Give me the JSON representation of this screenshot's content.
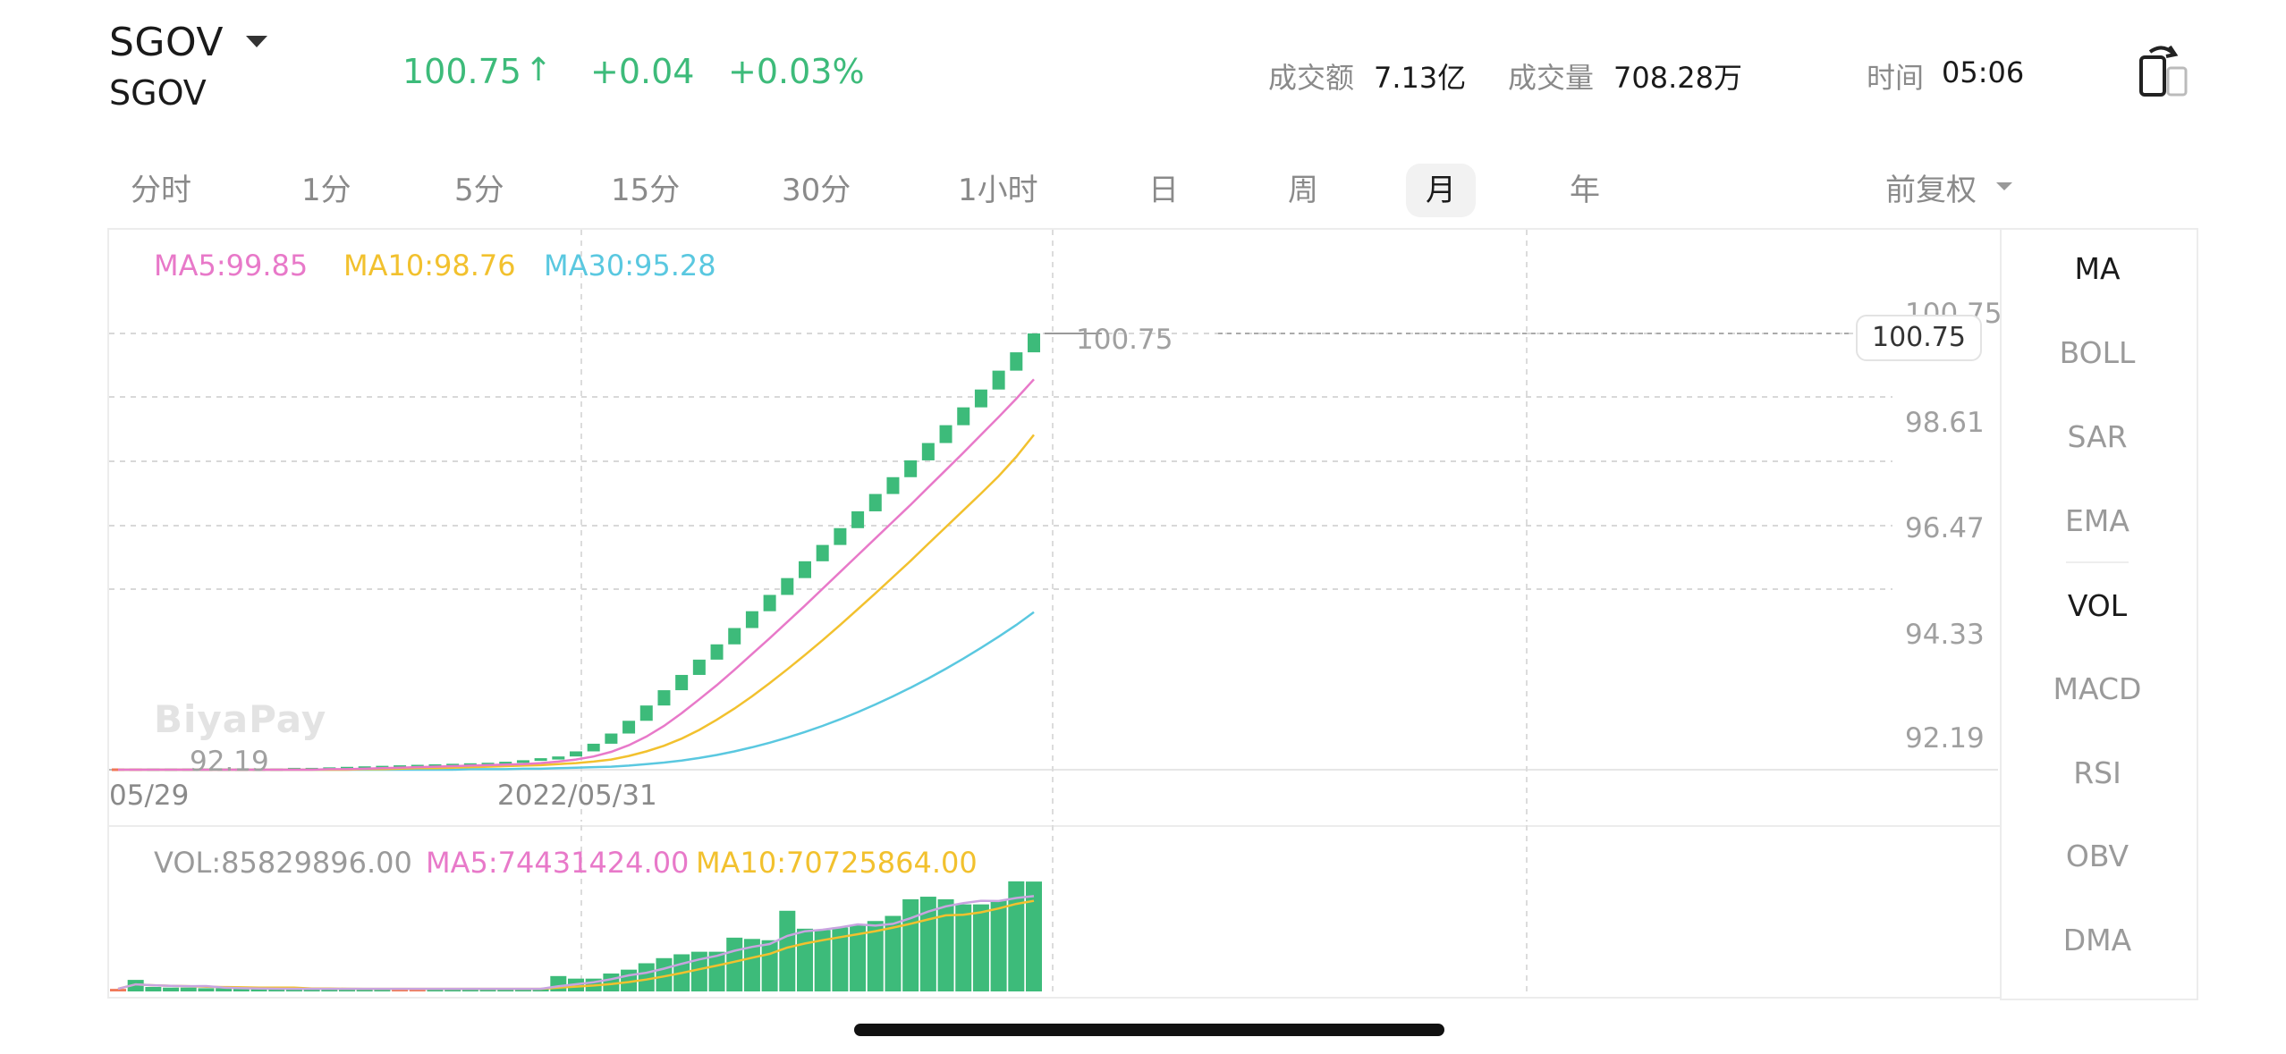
{
  "header": {
    "ticker": "SGOV",
    "name": "SGOV",
    "price": "100.75",
    "arrow": "↑",
    "change": "+0.04",
    "change_pct": "+0.03%",
    "turnover_label": "成交额",
    "turnover_value": "7.13亿",
    "volume_label": "成交量",
    "volume_value": "708.28万",
    "time_label": "时间",
    "time_value": "05:06"
  },
  "tabs": [
    {
      "label": "分时"
    },
    {
      "label": "1分"
    },
    {
      "label": "5分"
    },
    {
      "label": "15分"
    },
    {
      "label": "30分"
    },
    {
      "label": "1小时"
    },
    {
      "label": "日"
    },
    {
      "label": "周"
    },
    {
      "label": "月",
      "active": true
    },
    {
      "label": "年"
    }
  ],
  "adjust_label": "前复权",
  "indicators": {
    "main": [
      "MA",
      "BOLL",
      "SAR",
      "EMA"
    ],
    "sub": [
      "VOL",
      "MACD",
      "RSI",
      "OBV",
      "DMA"
    ],
    "active_main": "MA",
    "active_sub": "VOL"
  },
  "chart_legend": {
    "ma5": "MA5:99.85",
    "ma10": "MA10:98.76",
    "ma30": "MA30:95.28"
  },
  "vol_legend": {
    "vol": "VOL:85829896.00",
    "ma5": "MA5:74431424.00",
    "ma10": "MA10:70725864.00"
  },
  "watermark": "BiyaPay",
  "colors": {
    "up": "#3dbb7a",
    "down": "#f07858",
    "ma5": "#e879c9",
    "ma10": "#f2c12e",
    "ma30": "#5ac8e0"
  },
  "chart_data": {
    "type": "candlestick",
    "y_axis_labels": [
      "100.75",
      "98.61",
      "96.47",
      "94.33",
      "92.19"
    ],
    "ylim": [
      92.19,
      100.75
    ],
    "last_price_label": "100.75",
    "min_price_label": "92.19",
    "x_labels": [
      "05/29",
      "2022/05/31"
    ],
    "candles": [
      {
        "o": 92.19,
        "c": 92.19
      },
      {
        "o": 92.19,
        "c": 92.19
      },
      {
        "o": 92.19,
        "c": 92.19
      },
      {
        "o": 92.19,
        "c": 92.19
      },
      {
        "o": 92.19,
        "c": 92.19
      },
      {
        "o": 92.19,
        "c": 92.19
      },
      {
        "o": 92.19,
        "c": 92.19
      },
      {
        "o": 92.19,
        "c": 92.19
      },
      {
        "o": 92.19,
        "c": 92.19
      },
      {
        "o": 92.19,
        "c": 92.19
      },
      {
        "o": 92.19,
        "c": 92.2
      },
      {
        "o": 92.2,
        "c": 92.2
      },
      {
        "o": 92.2,
        "c": 92.21
      },
      {
        "o": 92.21,
        "c": 92.22
      },
      {
        "o": 92.22,
        "c": 92.23
      },
      {
        "o": 92.23,
        "c": 92.24
      },
      {
        "o": 92.24,
        "c": 92.25
      },
      {
        "o": 92.25,
        "c": 92.26
      },
      {
        "o": 92.26,
        "c": 92.27
      },
      {
        "o": 92.27,
        "c": 92.28
      },
      {
        "o": 92.28,
        "c": 92.29
      },
      {
        "o": 92.29,
        "c": 92.3
      },
      {
        "o": 92.3,
        "c": 92.32
      },
      {
        "o": 92.32,
        "c": 92.35
      },
      {
        "o": 92.35,
        "c": 92.39
      },
      {
        "o": 92.39,
        "c": 92.45
      },
      {
        "o": 92.45,
        "c": 92.55
      },
      {
        "o": 92.55,
        "c": 92.7
      },
      {
        "o": 92.7,
        "c": 92.9
      },
      {
        "o": 92.9,
        "c": 93.15
      },
      {
        "o": 93.15,
        "c": 93.45
      },
      {
        "o": 93.45,
        "c": 93.75
      },
      {
        "o": 93.75,
        "c": 94.05
      },
      {
        "o": 94.05,
        "c": 94.35
      },
      {
        "o": 94.35,
        "c": 94.65
      },
      {
        "o": 94.65,
        "c": 94.97
      },
      {
        "o": 94.97,
        "c": 95.3
      },
      {
        "o": 95.3,
        "c": 95.62
      },
      {
        "o": 95.62,
        "c": 95.95
      },
      {
        "o": 95.95,
        "c": 96.28
      },
      {
        "o": 96.28,
        "c": 96.6
      },
      {
        "o": 96.6,
        "c": 96.93
      },
      {
        "o": 96.93,
        "c": 97.26
      },
      {
        "o": 97.26,
        "c": 97.6
      },
      {
        "o": 97.6,
        "c": 97.93
      },
      {
        "o": 97.93,
        "c": 98.26
      },
      {
        "o": 98.26,
        "c": 98.6
      },
      {
        "o": 98.6,
        "c": 98.95
      },
      {
        "o": 98.95,
        "c": 99.3
      },
      {
        "o": 99.3,
        "c": 99.65
      },
      {
        "o": 99.65,
        "c": 100.02
      },
      {
        "o": 100.02,
        "c": 100.38
      },
      {
        "o": 100.38,
        "c": 100.75
      }
    ],
    "ma5": [
      92.19,
      92.19,
      92.19,
      92.19,
      92.19,
      92.19,
      92.19,
      92.19,
      92.19,
      92.19,
      92.19,
      92.19,
      92.2,
      92.2,
      92.21,
      92.22,
      92.23,
      92.24,
      92.25,
      92.26,
      92.27,
      92.28,
      92.29,
      92.3,
      92.32,
      92.35,
      92.39,
      92.45,
      92.54,
      92.67,
      92.84,
      93.05,
      93.3,
      93.57,
      93.85,
      94.15,
      94.46,
      94.77,
      95.09,
      95.41,
      95.74,
      96.07,
      96.4,
      96.73,
      97.06,
      97.39,
      97.73,
      98.07,
      98.41,
      98.76,
      99.11,
      99.47,
      99.85
    ],
    "ma10": [
      92.19,
      92.19,
      92.19,
      92.19,
      92.19,
      92.19,
      92.19,
      92.19,
      92.19,
      92.19,
      92.19,
      92.19,
      92.19,
      92.19,
      92.2,
      92.2,
      92.21,
      92.22,
      92.22,
      92.23,
      92.24,
      92.25,
      92.26,
      92.27,
      92.28,
      92.3,
      92.32,
      92.35,
      92.39,
      92.46,
      92.55,
      92.66,
      92.8,
      92.97,
      93.17,
      93.39,
      93.63,
      93.89,
      94.16,
      94.44,
      94.73,
      95.03,
      95.34,
      95.65,
      95.97,
      96.29,
      96.62,
      96.95,
      97.28,
      97.61,
      97.95,
      98.33,
      98.76
    ],
    "ma30": [
      92.19,
      92.19,
      92.19,
      92.19,
      92.19,
      92.19,
      92.19,
      92.19,
      92.19,
      92.19,
      92.19,
      92.19,
      92.19,
      92.19,
      92.19,
      92.19,
      92.19,
      92.19,
      92.19,
      92.19,
      92.2,
      92.2,
      92.2,
      92.21,
      92.21,
      92.22,
      92.23,
      92.24,
      92.25,
      92.27,
      92.3,
      92.33,
      92.37,
      92.42,
      92.48,
      92.55,
      92.63,
      92.72,
      92.82,
      92.93,
      93.05,
      93.18,
      93.32,
      93.47,
      93.63,
      93.8,
      93.98,
      94.17,
      94.37,
      94.58,
      94.8,
      95.03,
      95.28
    ],
    "volume_ylim": [
      0,
      88000000
    ],
    "volume": [
      2000000,
      9000000,
      3500000,
      3000000,
      3000000,
      2500000,
      2500000,
      2200000,
      2000000,
      2000000,
      2000000,
      2000000,
      2000000,
      2000000,
      2000000,
      2000000,
      2000000,
      2000000,
      2000000,
      2000000,
      2000000,
      2000000,
      2000000,
      2000000,
      2000000,
      12000000,
      10000000,
      10000000,
      14000000,
      17000000,
      22000000,
      26000000,
      29000000,
      31000000,
      31000000,
      42000000,
      41000000,
      40000000,
      63000000,
      49000000,
      48000000,
      50000000,
      52000000,
      55000000,
      59000000,
      72000000,
      74000000,
      72000000,
      68000000,
      68000000,
      71000000,
      86000000,
      85829896
    ],
    "volume_ma5": [
      2000000,
      5500000,
      4800000,
      4400000,
      4100000,
      4200000,
      2900000,
      2500000,
      2300000,
      2100000,
      2000000,
      2000000,
      2000000,
      2000000,
      2000000,
      2000000,
      2000000,
      2000000,
      2000000,
      2000000,
      2000000,
      2000000,
      2000000,
      2000000,
      2000000,
      4000000,
      5600000,
      7200000,
      9600000,
      12600000,
      14600000,
      17800000,
      21600000,
      25000000,
      27800000,
      31800000,
      34800000,
      37000000,
      43400000,
      47000000,
      48200000,
      50000000,
      52400000,
      51400000,
      52800000,
      57200000,
      62400000,
      66400000,
      69000000,
      70800000,
      70600000,
      73000000,
      74431424
    ],
    "volume_ma10": [
      2000000,
      5500000,
      4800000,
      4400000,
      4100000,
      3600000,
      3400000,
      3200000,
      3000000,
      2900000,
      2900000,
      2200000,
      2200000,
      2100000,
      2000000,
      2000000,
      2000000,
      2000000,
      2000000,
      2000000,
      2000000,
      2000000,
      2000000,
      2000000,
      2000000,
      3000000,
      3800000,
      4600000,
      5800000,
      7300000,
      9300000,
      11700000,
      14400000,
      17300000,
      20200000,
      23200000,
      26300000,
      29300000,
      34200000,
      37400000,
      40000000,
      42400000,
      44700000,
      47100000,
      49900000,
      52900000,
      56200000,
      59400000,
      59900000,
      61800000,
      64800000,
      68400000,
      70725864
    ]
  }
}
